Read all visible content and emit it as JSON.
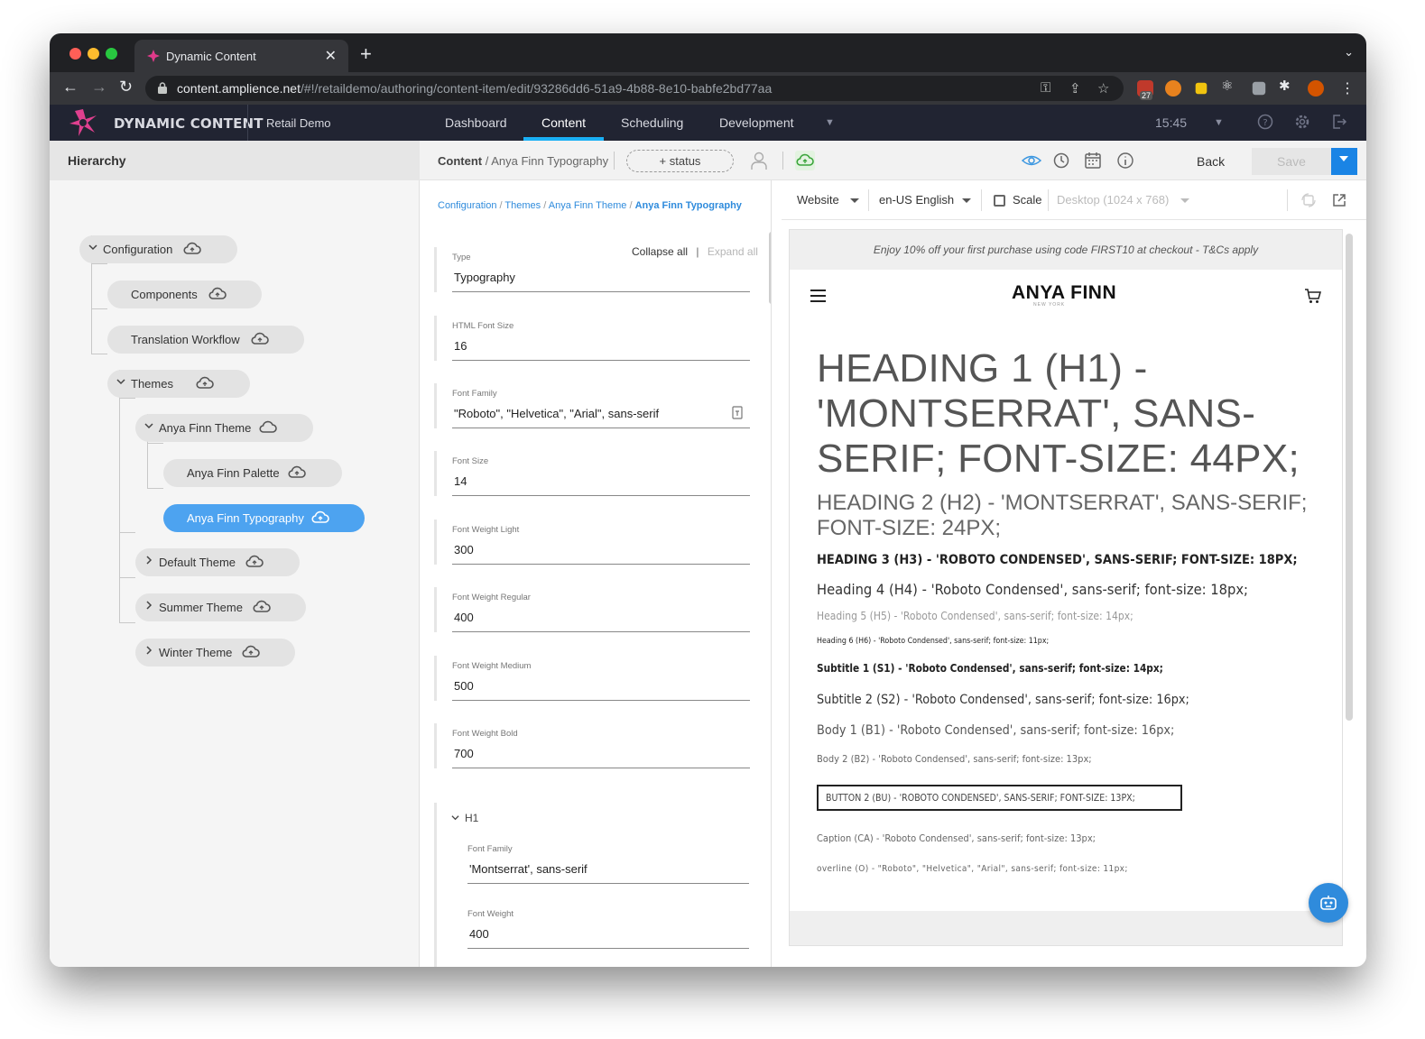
{
  "browser": {
    "tab_title": "Dynamic Content",
    "url_host": "content.amplience.net",
    "url_path": "/#!/retaildemo/authoring/content-item/edit/93286dd6-51a9-4b88-8e10-babfe2bd77aa",
    "ext_badge": "27"
  },
  "app": {
    "brand": "DYNAMIC CONTENT",
    "hub": "Retail Demo",
    "nav": [
      "Dashboard",
      "Content",
      "Scheduling",
      "Development"
    ],
    "active_nav": "Content",
    "time": "15:45",
    "accent": "#1ab0f5"
  },
  "hierarchy": {
    "title": "Hierarchy",
    "nodes": {
      "configuration": "Configuration",
      "components": "Components",
      "translation": "Translation Workflow",
      "themes": "Themes",
      "anya_theme": "Anya Finn Theme",
      "anya_palette": "Anya Finn Palette",
      "anya_typography": "Anya Finn Typography",
      "default_theme": "Default Theme",
      "summer_theme": "Summer Theme",
      "winter_theme": "Winter Theme"
    },
    "selected_color": "#4da3f0"
  },
  "toolbar": {
    "crumb_root": "Content",
    "crumb_item": " / Anya Finn Typography",
    "status": "+ status",
    "back": "Back",
    "save": "Save"
  },
  "form": {
    "breadcrumb": [
      "Configuration",
      "Themes",
      "Anya Finn Theme",
      "Anya Finn Typography"
    ],
    "collapse_all": "Collapse all",
    "expand_all": "Expand all",
    "fields": {
      "type": {
        "label": "Type",
        "value": "Typography"
      },
      "html_font_size": {
        "label": "HTML Font Size",
        "value": "16"
      },
      "font_family": {
        "label": "Font Family",
        "value": "\"Roboto\", \"Helvetica\", \"Arial\", sans-serif"
      },
      "font_size": {
        "label": "Font Size",
        "value": "14"
      },
      "fw_light": {
        "label": "Font Weight Light",
        "value": "300"
      },
      "fw_regular": {
        "label": "Font Weight Regular",
        "value": "400"
      },
      "fw_medium": {
        "label": "Font Weight Medium",
        "value": "500"
      },
      "fw_bold": {
        "label": "Font Weight Bold",
        "value": "700"
      }
    },
    "h1_section": {
      "title": "H1",
      "font_family": {
        "label": "Font Family",
        "value": "'Montserrat', sans-serif"
      },
      "font_weight": {
        "label": "Font Weight",
        "value": "400"
      }
    }
  },
  "preview": {
    "channel": "Website",
    "locale": "en-US English",
    "scale_label": "Scale",
    "scale_checked": false,
    "device": "Desktop (1024 x 768)",
    "promo": "Enjoy 10% off your first purchase using code FIRST10 at checkout - T&Cs apply",
    "brand_logo": "ANYA FINN",
    "brand_sub": "NEW YORK",
    "samples": {
      "h1": "Heading 1 (H1) - 'Montserrat', sans-serif; font-size: 44px;",
      "h2": "Heading 2 (H2) - 'Montserrat', sans-serif; font-size: 24px;",
      "h3": "Heading 3 (H3) - 'Roboto Condensed', sans-serif; font-size: 18px;",
      "h4": "Heading 4 (H4) - 'Roboto Condensed', sans-serif; font-size: 18px;",
      "h5": "Heading 5 (H5) - 'Roboto Condensed', sans-serif; font-size: 14px;",
      "h6": "Heading 6 (H6) - 'Roboto Condensed', sans-serif; font-size: 11px;",
      "s1": "Subtitle 1 (S1) - 'Roboto Condensed', sans-serif; font-size: 14px;",
      "s2": "Subtitle 2 (S2) - 'Roboto Condensed', sans-serif; font-size: 16px;",
      "b1": "Body 1 (B1) - 'Roboto Condensed', sans-serif; font-size: 16px;",
      "b2": "Body 2 (B2) - 'Roboto Condensed', sans-serif; font-size: 13px;",
      "button": "Button 2 (BU) - 'Roboto Condensed', sans-serif; font-size: 13px;",
      "caption": "Caption (CA) - 'Roboto Condensed', sans-serif; font-size: 13px;",
      "overline": "overline (O) - \"Roboto\", \"Helvetica\", \"Arial\", sans-serif; font-size: 11px;"
    }
  }
}
